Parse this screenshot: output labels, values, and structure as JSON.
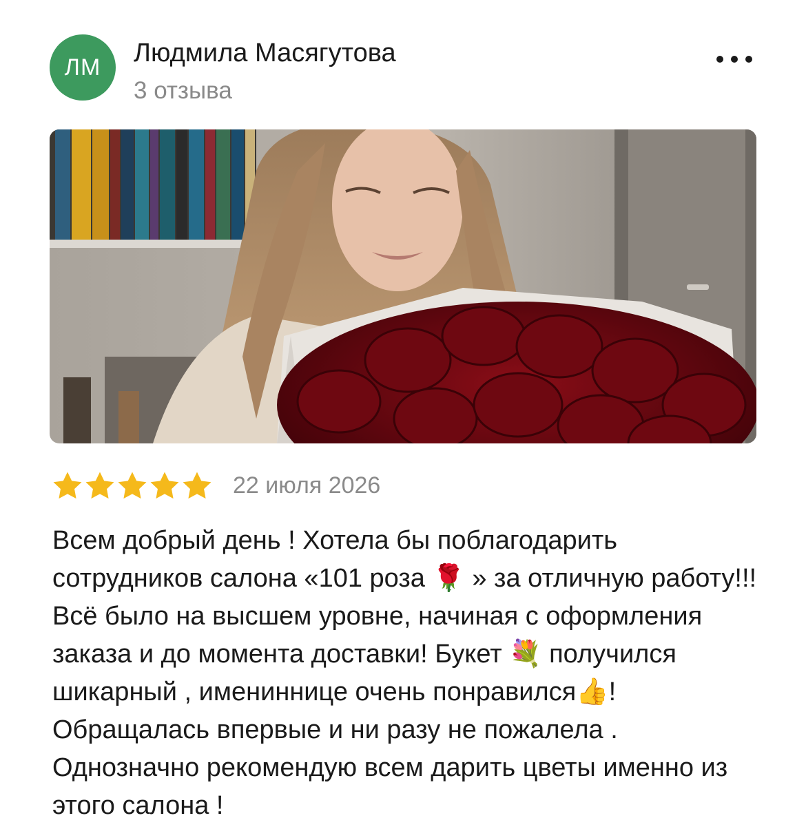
{
  "review": {
    "avatar_initials": "ЛМ",
    "author_name": "Людмила Масягутова",
    "reviews_count": "3 отзыва",
    "rating": 5,
    "rating_max": 5,
    "date": "22 июля 2026",
    "text": "Всем добрый день ! Хотела бы поблагодарить сотрудников салона «101 роза 🌹 » за отличную работу!!! Всё было на высшем уровне, начиная с оформления заказа и до момента доставки! Букет 💐 получился шикарный , имениннице очень понравился👍! Обращалась впервые и ни разу не пожалела . Однозначно рекомендую всем дарить цветы именно из этого салона !"
  },
  "icons": {
    "more": "more-horizontal-icon",
    "star": "star-icon"
  },
  "colors": {
    "avatar_bg": "#3d9a5e",
    "star": "#f5b91b",
    "secondary_text": "#8a8a8a",
    "primary_text": "#1a1a1a"
  }
}
